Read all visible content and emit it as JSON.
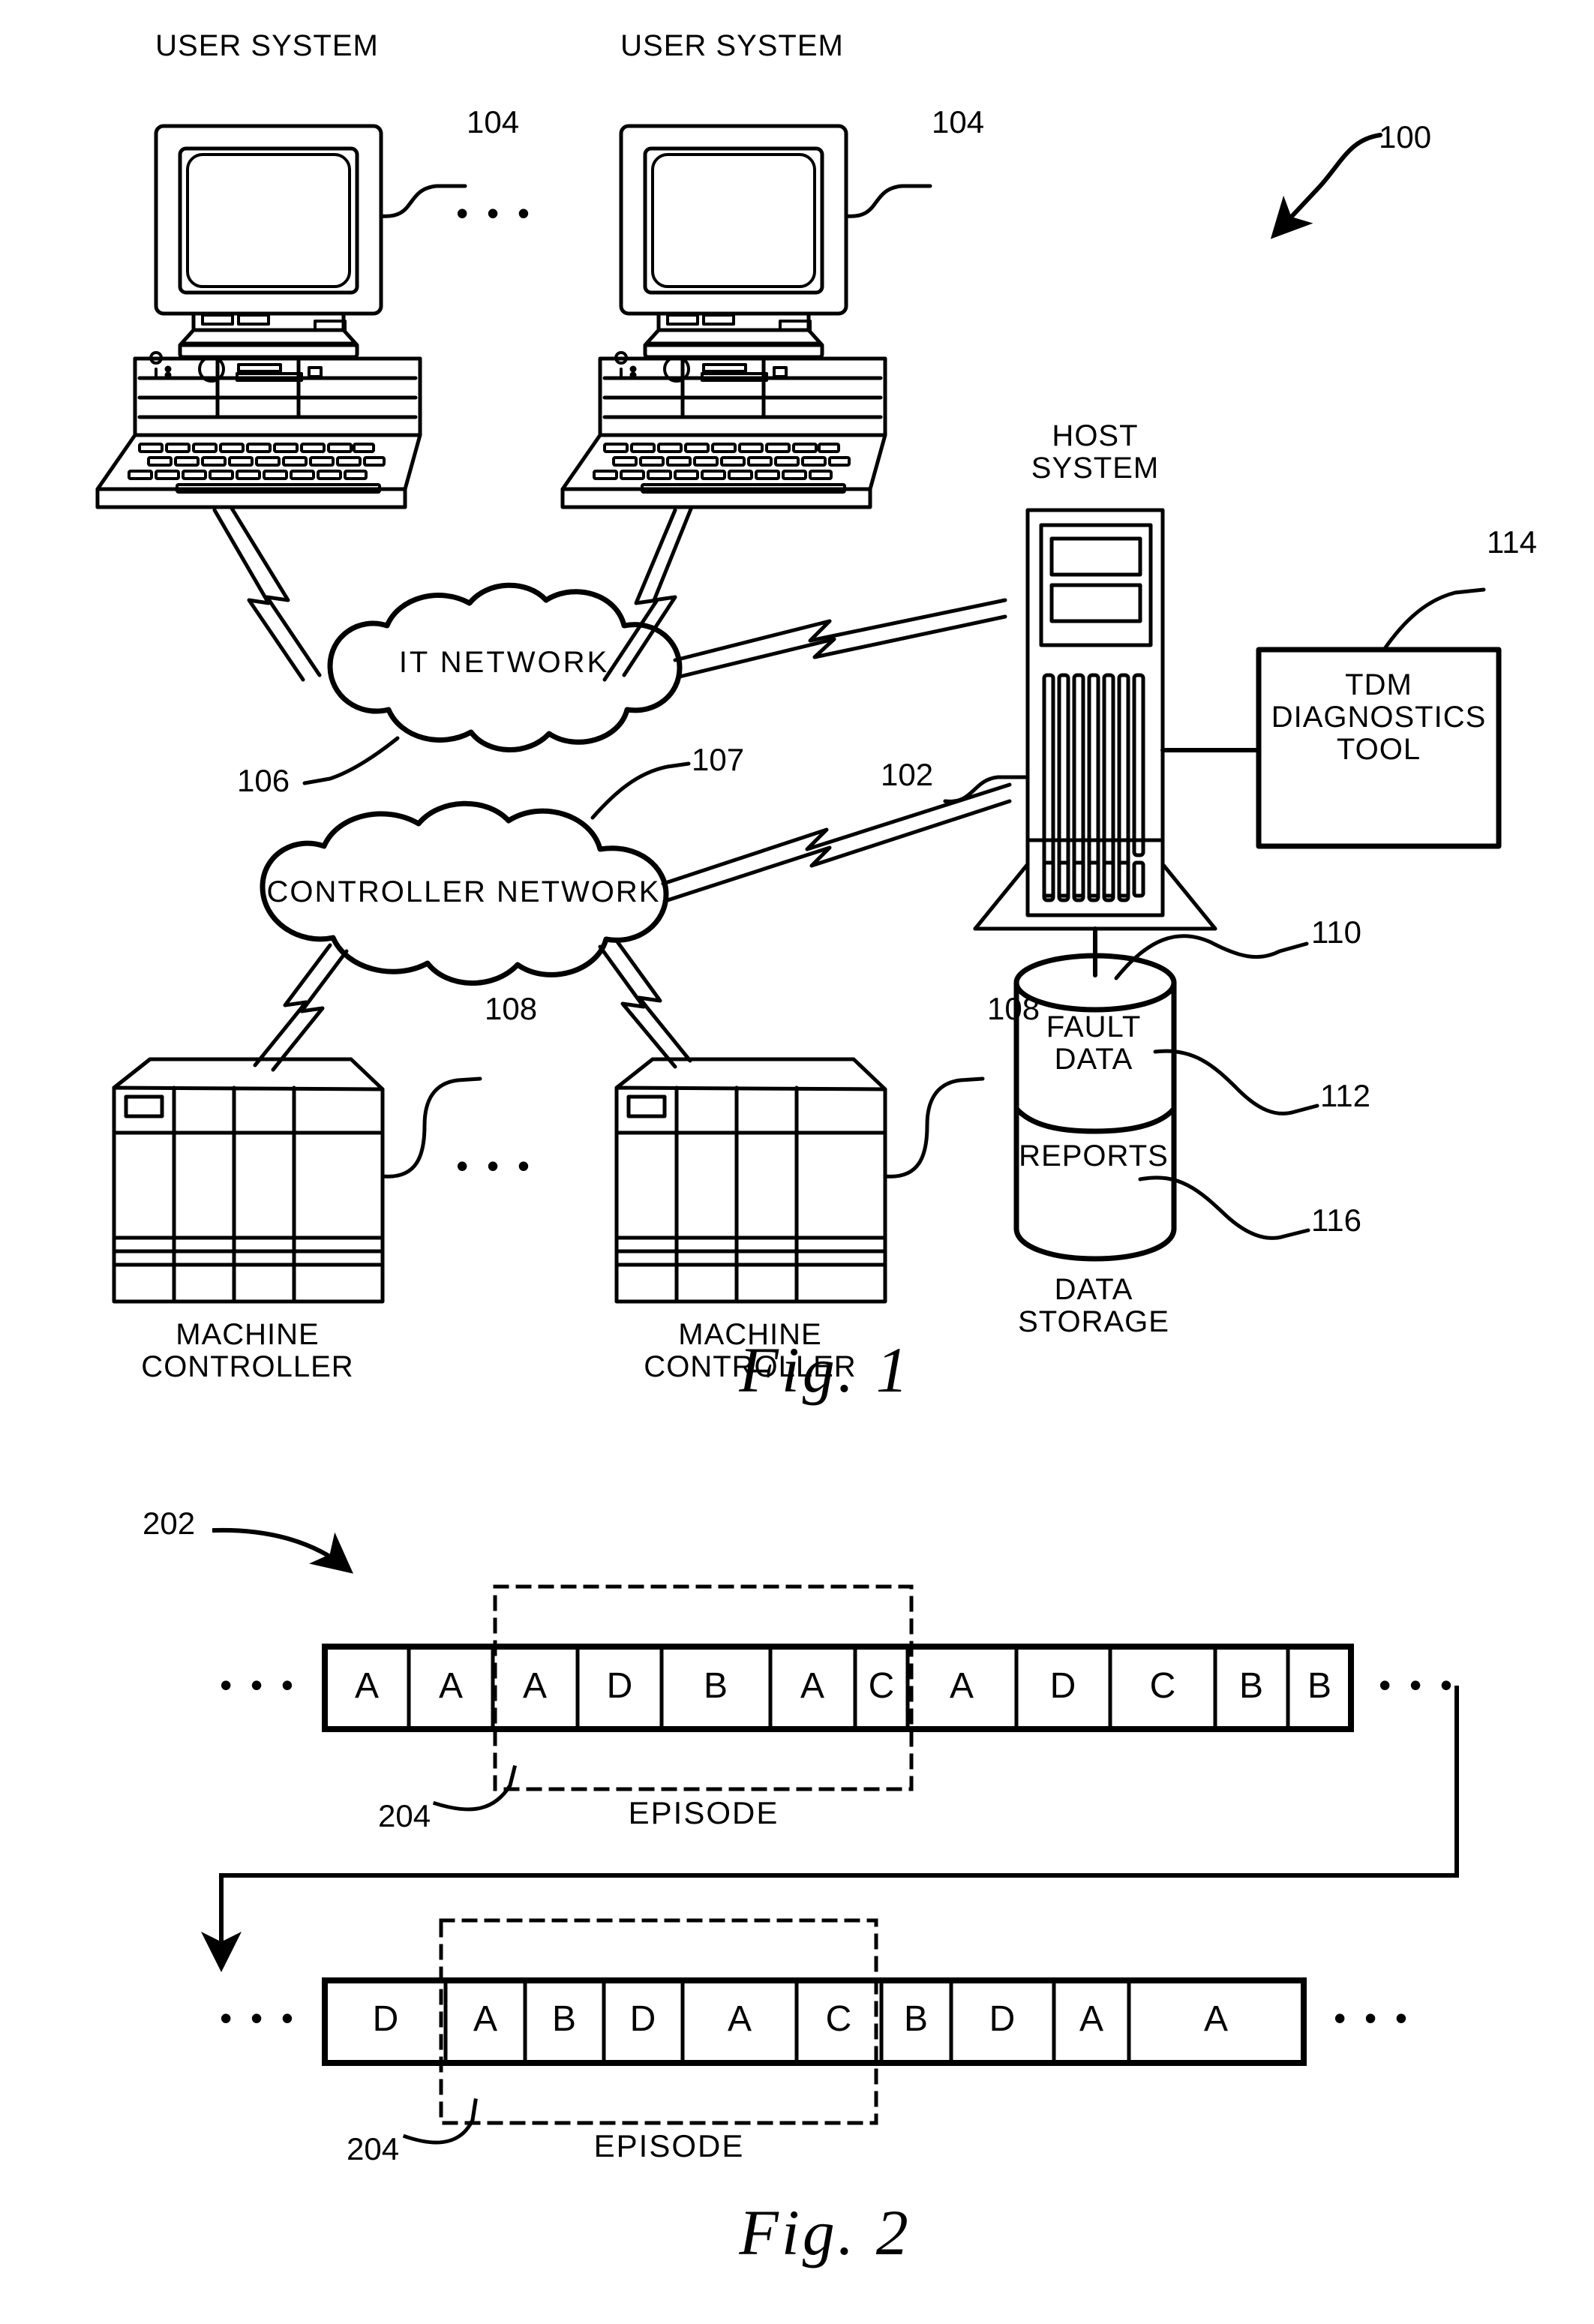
{
  "figure1": {
    "caption": "Fig. 1",
    "system_ref": "100",
    "nodes": {
      "user_system_left": {
        "label": "USER SYSTEM",
        "ref": "104"
      },
      "user_system_right": {
        "label": "USER SYSTEM",
        "ref": "104"
      },
      "ellipsis_users": "• • •",
      "it_network": {
        "label": "IT NETWORK",
        "ref": "106"
      },
      "controller_network": {
        "label": "CONTROLLER NETWORK",
        "ref": "107"
      },
      "host_system": {
        "label": "HOST\nSYSTEM",
        "ref": "102"
      },
      "tdm_tool": {
        "label": "TDM\nDIAGNOSTICS\nTOOL",
        "ref": "114"
      },
      "data_storage": {
        "label": "DATA\nSTORAGE",
        "ref": "110"
      },
      "fault_data": {
        "label": "FAULT\nDATA",
        "ref": "112"
      },
      "reports": {
        "label": "REPORTS",
        "ref": "116"
      },
      "machine_controller_left": {
        "label": "MACHINE\nCONTROLLER",
        "ref": "108"
      },
      "machine_controller_right": {
        "label": "MACHINE\nCONTROLLER",
        "ref": "108"
      },
      "ellipsis_controllers": "• • •"
    }
  },
  "figure2": {
    "caption": "Fig. 2",
    "sequence_ref": "202",
    "episode_ref": "204",
    "episode_label": "EPISODE",
    "ellipsis": "• • •",
    "rows": [
      {
        "cells": [
          "A",
          "A",
          "A",
          "D",
          "B",
          "A",
          "C",
          "A",
          "D",
          "C",
          "B",
          "B"
        ],
        "episode_start_index": 2,
        "episode_end_index": 6
      },
      {
        "cells": [
          "D",
          "A",
          "B",
          "D",
          "A",
          "C",
          "B",
          "D",
          "A",
          "A"
        ],
        "episode_start_index": 1,
        "episode_end_index": 5
      }
    ]
  },
  "colors": {
    "ink": "#000000",
    "paper": "#ffffff"
  }
}
